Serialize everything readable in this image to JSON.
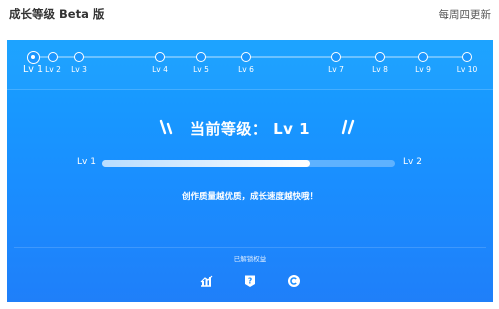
{
  "header": {
    "title": "成长等级 Beta 版",
    "right_text": "每周四更新"
  },
  "levels": {
    "current_index": 0,
    "items": [
      {
        "label": "Lv 1"
      },
      {
        "label": "Lv 2"
      },
      {
        "label": "Lv 3"
      },
      {
        "label": "Lv 4"
      },
      {
        "label": "Lv 5"
      },
      {
        "label": "Lv 6"
      },
      {
        "label": "Lv 7"
      },
      {
        "label": "Lv 8"
      },
      {
        "label": "Lv 9"
      },
      {
        "label": "Lv 10"
      }
    ]
  },
  "current_level": {
    "title": "当前等级： Lv 1"
  },
  "progress": {
    "from_label": "Lv 1",
    "to_label": "Lv 2",
    "fraction": 0.71
  },
  "slogan": "创作质量越优质，成长速度越快哦！",
  "benefits": {
    "title": "已解锁权益",
    "icons": [
      "chart-icon",
      "question-badge-icon",
      "copyright-icon"
    ]
  },
  "colors": {
    "card_top": "#16a1ff",
    "card_bottom": "#1f7ff9",
    "text": "#ffffff"
  }
}
